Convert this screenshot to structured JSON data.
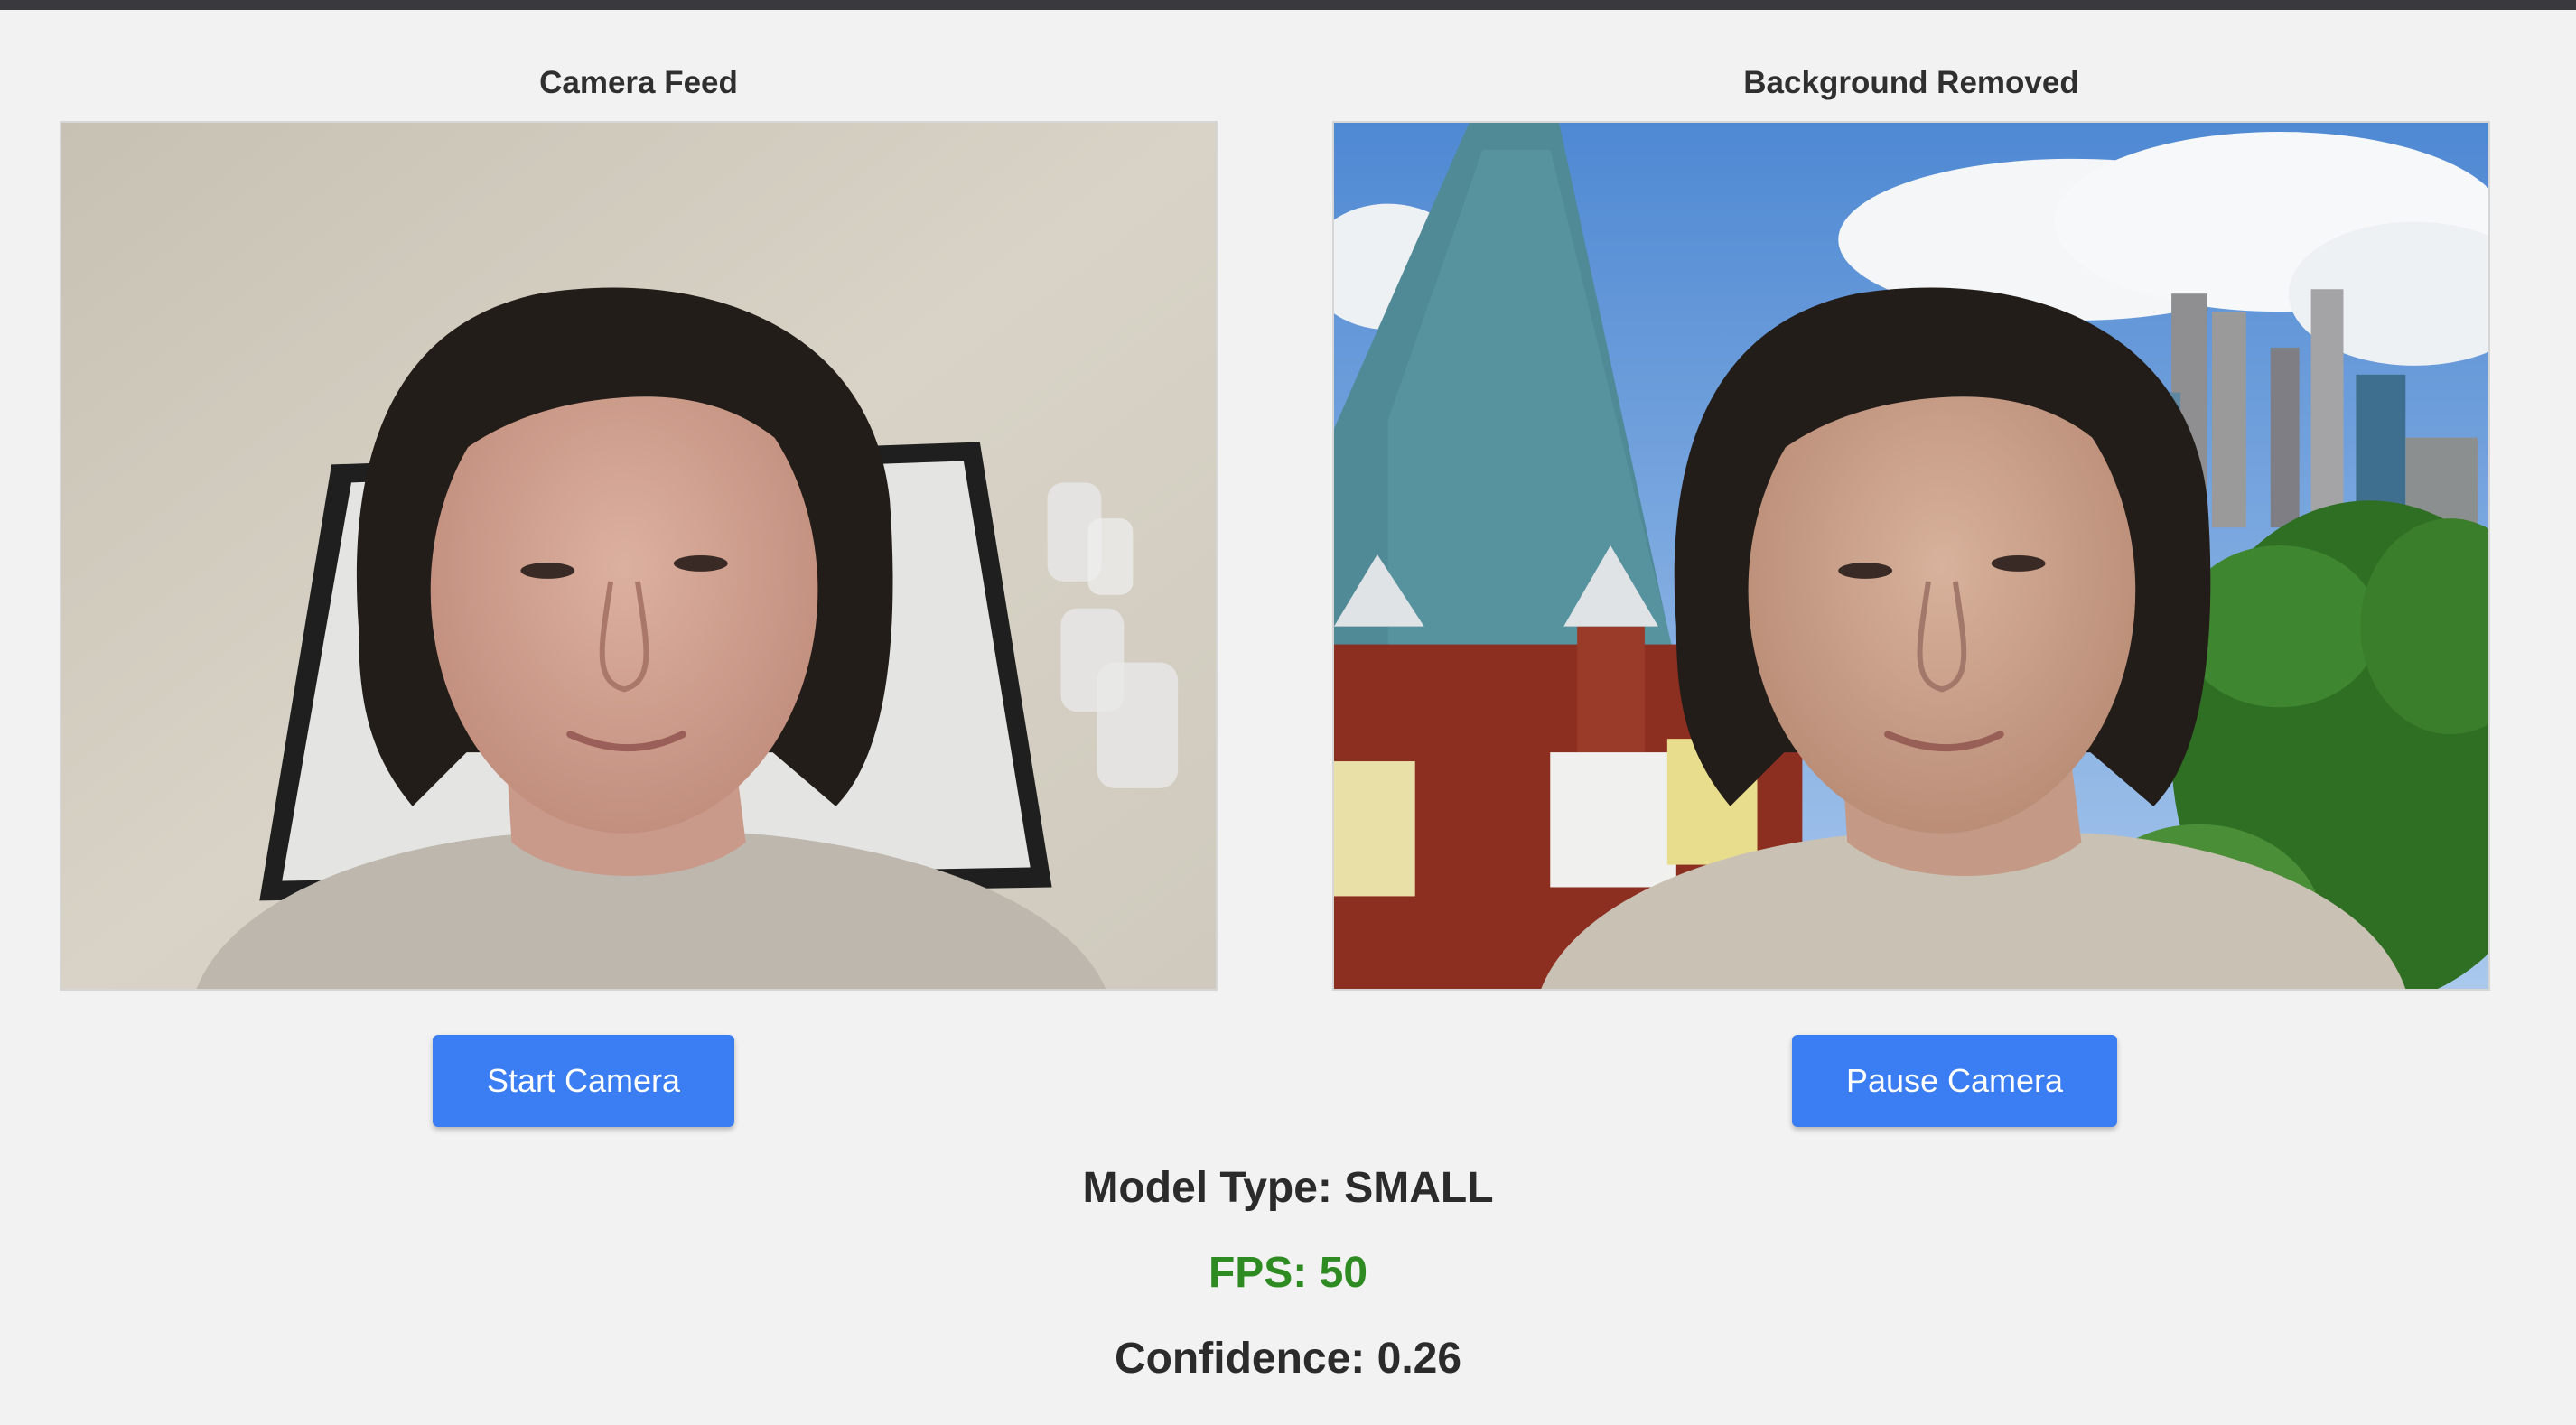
{
  "camera_panel": {
    "title": "Camera Feed",
    "start_button_label": "Start Camera"
  },
  "processed_panel": {
    "title": "Background Removed",
    "pause_button_label": "Pause Camera"
  },
  "stats": {
    "model_type_label": "Model Type:",
    "model_type_value": "SMALL",
    "fps_label": "FPS:",
    "fps_value": "50",
    "confidence_label": "Confidence:",
    "confidence_value": "0.26"
  },
  "colors": {
    "button": "#3b7df2",
    "fps_text": "#2e8b22",
    "background": "#f2f2f2",
    "top_bar": "#3a3a3e"
  }
}
